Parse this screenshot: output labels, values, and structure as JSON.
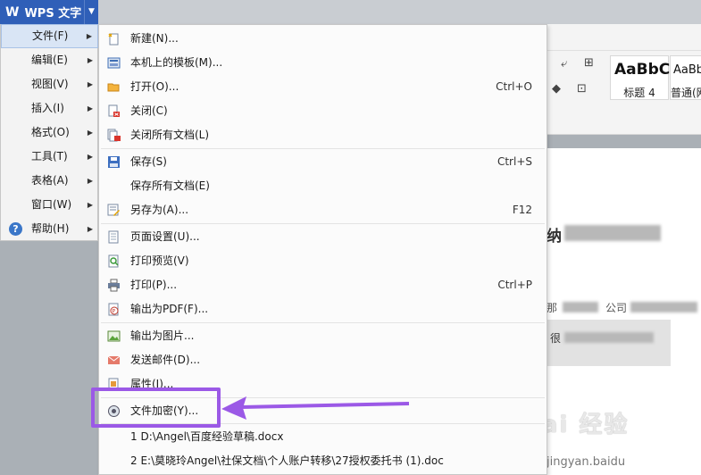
{
  "app": {
    "title": "WPS 文字"
  },
  "ribbon": {
    "styles": [
      {
        "sample": "AaBbC",
        "caption": "标题 4"
      },
      {
        "sample": "AaBb",
        "caption": "普通(网"
      }
    ]
  },
  "document": {
    "heading_fragment": "纳",
    "line_a": "那",
    "line_b": "公司",
    "line_c": "很"
  },
  "watermark": {
    "text": "Bai 经验",
    "sub": "jingyan.baidu"
  },
  "left_menu": {
    "items": [
      {
        "label": "文件(F)"
      },
      {
        "label": "编辑(E)"
      },
      {
        "label": "视图(V)"
      },
      {
        "label": "插入(I)"
      },
      {
        "label": "格式(O)"
      },
      {
        "label": "工具(T)"
      },
      {
        "label": "表格(A)"
      },
      {
        "label": "窗口(W)"
      },
      {
        "label": "帮助(H)"
      }
    ]
  },
  "file_menu": {
    "items": [
      {
        "label": "新建(N)...",
        "shortcut": "",
        "icon": "new-doc-icon"
      },
      {
        "label": "本机上的模板(M)...",
        "shortcut": "",
        "icon": "template-icon"
      },
      {
        "label": "打开(O)...",
        "shortcut": "Ctrl+O",
        "icon": "folder-open-icon"
      },
      {
        "label": "关闭(C)",
        "shortcut": "",
        "icon": "close-doc-icon"
      },
      {
        "label": "关闭所有文档(L)",
        "shortcut": "",
        "icon": "close-all-icon"
      },
      {
        "label": "保存(S)",
        "shortcut": "Ctrl+S",
        "icon": "save-icon"
      },
      {
        "label": "保存所有文档(E)",
        "shortcut": "",
        "icon": ""
      },
      {
        "label": "另存为(A)...",
        "shortcut": "F12",
        "icon": "save-as-icon"
      },
      {
        "label": "页面设置(U)...",
        "shortcut": "",
        "icon": "page-setup-icon"
      },
      {
        "label": "打印预览(V)",
        "shortcut": "",
        "icon": "print-preview-icon"
      },
      {
        "label": "打印(P)...",
        "shortcut": "Ctrl+P",
        "icon": "printer-icon"
      },
      {
        "label": "输出为PDF(F)...",
        "shortcut": "",
        "icon": "pdf-icon"
      },
      {
        "label": "输出为图片...",
        "shortcut": "",
        "icon": "image-export-icon"
      },
      {
        "label": "发送邮件(D)...",
        "shortcut": "",
        "icon": "mail-icon"
      },
      {
        "label": "属性(I)...",
        "shortcut": "",
        "icon": "properties-icon"
      },
      {
        "label": "文件加密(Y)...",
        "shortcut": "",
        "icon": "encrypt-icon"
      },
      {
        "label": "1 D:\\Angel\\百度经验草稿.docx",
        "shortcut": "",
        "icon": ""
      },
      {
        "label": "2 E:\\莫晓玲Angel\\社保文档\\个人账户转移\\27授权委托书 (1).doc",
        "shortcut": "",
        "icon": ""
      }
    ]
  },
  "colors": {
    "accent": "#2f5fb8",
    "highlight": "#9b59e6",
    "menu_bg": "#fbfbfb"
  }
}
